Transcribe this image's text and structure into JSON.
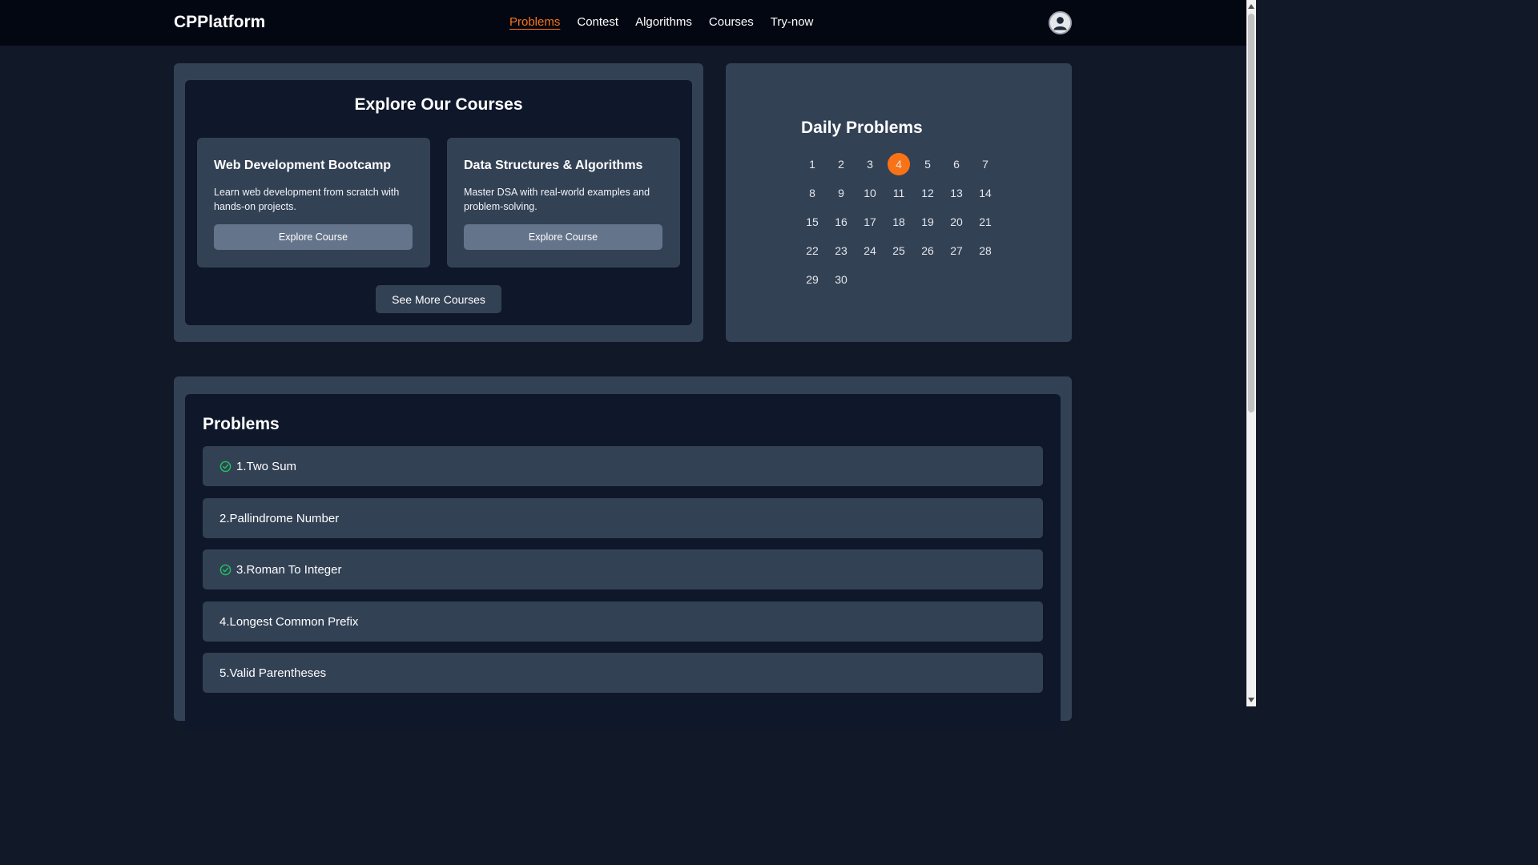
{
  "nav": {
    "brand": "CPPlatform",
    "links": [
      {
        "label": "Problems",
        "active": true
      },
      {
        "label": "Contest"
      },
      {
        "label": "Algorithms"
      },
      {
        "label": "Courses"
      },
      {
        "label": "Try-now"
      }
    ],
    "avatar_icon": "user-avatar-icon"
  },
  "courses": {
    "title": "Explore Our Courses",
    "items": [
      {
        "title": "Web Development Bootcamp",
        "description": "Learn web development from scratch with hands-on projects.",
        "button": "Explore Course"
      },
      {
        "title": "Data Structures & Algorithms",
        "description": "Master DSA with real-world examples and problem-solving.",
        "button": "Explore Course"
      }
    ],
    "see_more": "See More Courses"
  },
  "daily": {
    "title": "Daily Problems",
    "days": [
      "1",
      "2",
      "3",
      "4",
      "5",
      "6",
      "7",
      "8",
      "9",
      "10",
      "11",
      "12",
      "13",
      "14",
      "15",
      "16",
      "17",
      "18",
      "19",
      "20",
      "21",
      "22",
      "23",
      "24",
      "25",
      "26",
      "27",
      "28",
      "29",
      "30"
    ],
    "active_day": "4"
  },
  "problems": {
    "title": "Problems",
    "items": [
      {
        "label": "1.Two Sum",
        "solved": true
      },
      {
        "label": "2.Pallindrome Number",
        "solved": false
      },
      {
        "label": "3.Roman To Integer",
        "solved": true
      },
      {
        "label": "4.Longest Common Prefix",
        "solved": false
      },
      {
        "label": "5.Valid Parentheses",
        "solved": false
      }
    ]
  },
  "colors": {
    "accent": "#f97316",
    "solved_check": "#22c55e",
    "page_bg": "#111827",
    "panel_bg": "#334155",
    "inner_bg": "#0f172a"
  }
}
